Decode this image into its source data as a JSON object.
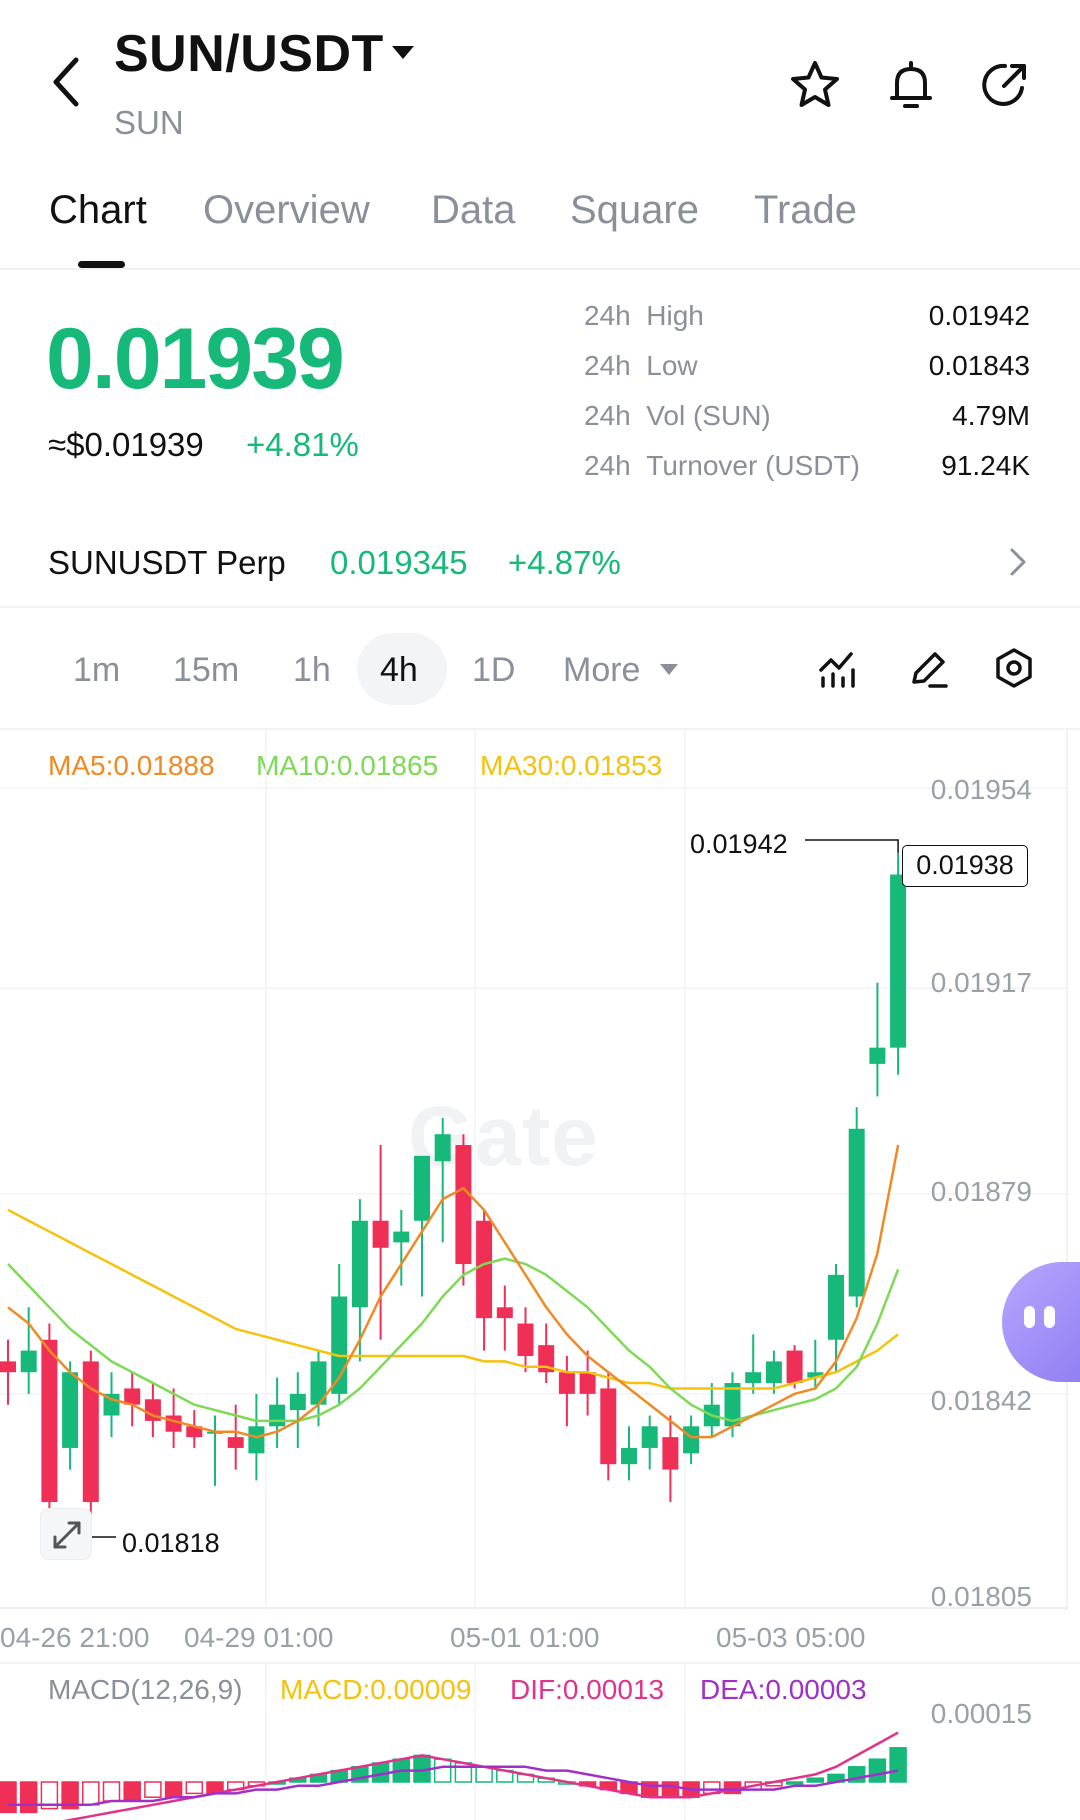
{
  "header": {
    "pair": "SUN/USDT",
    "base": "SUN"
  },
  "tabs": [
    "Chart",
    "Overview",
    "Data",
    "Square",
    "Trade"
  ],
  "price": {
    "last": "0.01939",
    "usd": "≈$0.01939",
    "change": "+4.81%"
  },
  "stats": [
    {
      "period": "24h",
      "label": "High",
      "value": "0.01942"
    },
    {
      "period": "24h",
      "label": "Low",
      "value": "0.01843"
    },
    {
      "period": "24h",
      "label": "Vol (SUN)",
      "value": "4.79M"
    },
    {
      "period": "24h",
      "label": "Turnover (USDT)",
      "value": "91.24K"
    }
  ],
  "perp": {
    "name": "SUNUSDT Perp",
    "price": "0.019345",
    "change": "+4.87%"
  },
  "intervals": {
    "items": [
      "1m",
      "15m",
      "1h",
      "4h",
      "1D",
      "More"
    ],
    "active": "4h"
  },
  "ma_legend": {
    "ma5": "MA5:0.01888",
    "ma10": "MA10:0.01865",
    "ma30": "MA30:0.01853"
  },
  "colors": {
    "up": "#16b979",
    "down": "#ef2f56",
    "ma5": "#f08a24",
    "ma10": "#7ed957",
    "ma30": "#f5c20e",
    "dif": "#e0338b",
    "dea": "#a030c8",
    "macd_label": "#f5c20e"
  },
  "annotations": {
    "high": "0.01942",
    "low": "0.01818",
    "current": "0.01938"
  },
  "watermark": "Gate",
  "macd_legend": {
    "title": "MACD(12,26,9)",
    "macd": "MACD:0.00009",
    "dif": "DIF:0.00013",
    "dea": "DEA:0.00003"
  },
  "macd_axis": "0.00015",
  "chart_data": {
    "type": "candlestick",
    "y_ticks": [
      "0.01954",
      "0.01917",
      "0.01879",
      "0.01842",
      "0.01805"
    ],
    "x_ticks": [
      "04-26 21:00",
      "04-29 01:00",
      "05-01 01:00",
      "05-03 05:00"
    ],
    "ylim": [
      0.01805,
      0.01954
    ],
    "candles": [
      {
        "o": 0.01848,
        "h": 0.01852,
        "l": 0.0184,
        "c": 0.01846
      },
      {
        "o": 0.01846,
        "h": 0.01858,
        "l": 0.01842,
        "c": 0.0185
      },
      {
        "o": 0.01852,
        "h": 0.01855,
        "l": 0.01818,
        "c": 0.01822
      },
      {
        "o": 0.01832,
        "h": 0.01848,
        "l": 0.01828,
        "c": 0.01846
      },
      {
        "o": 0.01848,
        "h": 0.0185,
        "l": 0.01818,
        "c": 0.01822
      },
      {
        "o": 0.01838,
        "h": 0.01846,
        "l": 0.01834,
        "c": 0.01842
      },
      {
        "o": 0.01843,
        "h": 0.01846,
        "l": 0.01836,
        "c": 0.0184
      },
      {
        "o": 0.01841,
        "h": 0.01844,
        "l": 0.01834,
        "c": 0.01837
      },
      {
        "o": 0.01838,
        "h": 0.01843,
        "l": 0.01832,
        "c": 0.01835
      },
      {
        "o": 0.01836,
        "h": 0.01839,
        "l": 0.01832,
        "c": 0.01834
      },
      {
        "o": 0.01835,
        "h": 0.01838,
        "l": 0.01825,
        "c": 0.01835
      },
      {
        "o": 0.01834,
        "h": 0.0184,
        "l": 0.01828,
        "c": 0.01832
      },
      {
        "o": 0.01831,
        "h": 0.01842,
        "l": 0.01826,
        "c": 0.01836
      },
      {
        "o": 0.01836,
        "h": 0.01845,
        "l": 0.01832,
        "c": 0.0184
      },
      {
        "o": 0.01839,
        "h": 0.01846,
        "l": 0.01832,
        "c": 0.01842
      },
      {
        "o": 0.0184,
        "h": 0.0185,
        "l": 0.01836,
        "c": 0.01848
      },
      {
        "o": 0.01842,
        "h": 0.01866,
        "l": 0.0184,
        "c": 0.0186
      },
      {
        "o": 0.01858,
        "h": 0.01878,
        "l": 0.01848,
        "c": 0.01874
      },
      {
        "o": 0.01874,
        "h": 0.01888,
        "l": 0.01852,
        "c": 0.01869
      },
      {
        "o": 0.0187,
        "h": 0.01876,
        "l": 0.01862,
        "c": 0.01872
      },
      {
        "o": 0.01874,
        "h": 0.01885,
        "l": 0.0186,
        "c": 0.01886
      },
      {
        "o": 0.01885,
        "h": 0.01893,
        "l": 0.0187,
        "c": 0.0189
      },
      {
        "o": 0.01888,
        "h": 0.0189,
        "l": 0.01862,
        "c": 0.01866
      },
      {
        "o": 0.01874,
        "h": 0.01876,
        "l": 0.0185,
        "c": 0.01856
      },
      {
        "o": 0.01858,
        "h": 0.01862,
        "l": 0.0185,
        "c": 0.01856
      },
      {
        "o": 0.01855,
        "h": 0.01858,
        "l": 0.01846,
        "c": 0.01849
      },
      {
        "o": 0.01851,
        "h": 0.01855,
        "l": 0.01844,
        "c": 0.01846
      },
      {
        "o": 0.01846,
        "h": 0.01849,
        "l": 0.01836,
        "c": 0.01842
      },
      {
        "o": 0.01846,
        "h": 0.0185,
        "l": 0.01838,
        "c": 0.01842
      },
      {
        "o": 0.01843,
        "h": 0.01846,
        "l": 0.01826,
        "c": 0.01829
      },
      {
        "o": 0.01829,
        "h": 0.01836,
        "l": 0.01826,
        "c": 0.01832
      },
      {
        "o": 0.01832,
        "h": 0.01838,
        "l": 0.01828,
        "c": 0.01836
      },
      {
        "o": 0.01834,
        "h": 0.01838,
        "l": 0.01822,
        "c": 0.01828
      },
      {
        "o": 0.01831,
        "h": 0.01838,
        "l": 0.01829,
        "c": 0.01836
      },
      {
        "o": 0.01836,
        "h": 0.01844,
        "l": 0.01834,
        "c": 0.0184
      },
      {
        "o": 0.01836,
        "h": 0.01846,
        "l": 0.01834,
        "c": 0.01844
      },
      {
        "o": 0.01844,
        "h": 0.01853,
        "l": 0.01842,
        "c": 0.01846
      },
      {
        "o": 0.01844,
        "h": 0.0185,
        "l": 0.01842,
        "c": 0.01848
      },
      {
        "o": 0.0185,
        "h": 0.01851,
        "l": 0.01843,
        "c": 0.01844
      },
      {
        "o": 0.01845,
        "h": 0.01852,
        "l": 0.01843,
        "c": 0.01846
      },
      {
        "o": 0.01852,
        "h": 0.01866,
        "l": 0.01846,
        "c": 0.01864
      },
      {
        "o": 0.0186,
        "h": 0.01895,
        "l": 0.01858,
        "c": 0.01891
      },
      {
        "o": 0.01903,
        "h": 0.01918,
        "l": 0.01897,
        "c": 0.01906
      },
      {
        "o": 0.01906,
        "h": 0.01942,
        "l": 0.01901,
        "c": 0.01938
      }
    ],
    "ma5": [
      0.01858,
      0.01855,
      0.0185,
      0.01846,
      0.01843,
      0.01841,
      0.0184,
      0.01838,
      0.01837,
      0.01836,
      0.01835,
      0.01835,
      0.01834,
      0.01835,
      0.01837,
      0.0184,
      0.01845,
      0.01852,
      0.0186,
      0.01866,
      0.01872,
      0.01878,
      0.0188,
      0.01876,
      0.0187,
      0.01864,
      0.01858,
      0.01853,
      0.01849,
      0.01846,
      0.01843,
      0.0184,
      0.01837,
      0.01834,
      0.01834,
      0.01836,
      0.01838,
      0.0184,
      0.01842,
      0.01843,
      0.01848,
      0.01856,
      0.01868,
      0.01888
    ],
    "ma10": [
      0.01866,
      0.01862,
      0.01858,
      0.01854,
      0.01851,
      0.01848,
      0.01846,
      0.01844,
      0.01842,
      0.0184,
      0.01839,
      0.01838,
      0.01837,
      0.01837,
      0.01837,
      0.01838,
      0.0184,
      0.01843,
      0.01847,
      0.01851,
      0.01855,
      0.0186,
      0.01864,
      0.01866,
      0.01867,
      0.01866,
      0.01864,
      0.01861,
      0.01858,
      0.01854,
      0.0185,
      0.01847,
      0.01843,
      0.0184,
      0.01838,
      0.01837,
      0.01838,
      0.01839,
      0.0184,
      0.01841,
      0.01843,
      0.01847,
      0.01855,
      0.01865
    ],
    "ma30": [
      0.01876,
      0.01874,
      0.01872,
      0.0187,
      0.01868,
      0.01866,
      0.01864,
      0.01862,
      0.0186,
      0.01858,
      0.01856,
      0.01854,
      0.01853,
      0.01852,
      0.01851,
      0.0185,
      0.01849,
      0.01849,
      0.01849,
      0.01849,
      0.01849,
      0.01849,
      0.01849,
      0.01848,
      0.01848,
      0.01847,
      0.01847,
      0.01846,
      0.01846,
      0.01845,
      0.01844,
      0.01844,
      0.01843,
      0.01843,
      0.01843,
      0.01843,
      0.01843,
      0.01843,
      0.01844,
      0.01845,
      0.01846,
      0.01848,
      0.0185,
      0.01853
    ],
    "macd_hist": [
      -8e-05,
      -8e-05,
      -7e-05,
      -7e-05,
      -6e-05,
      -5e-05,
      -5e-05,
      -4e-05,
      -4e-05,
      -3e-05,
      -3e-05,
      -2e-05,
      -1e-05,
      0.0,
      1e-05,
      2e-05,
      3e-05,
      4e-05,
      5e-05,
      6e-05,
      7e-05,
      6e-05,
      5e-05,
      4e-05,
      3e-05,
      2e-05,
      1e-05,
      0.0,
      -1e-05,
      -2e-05,
      -3e-05,
      -4e-05,
      -4e-05,
      -4e-05,
      -3e-05,
      -3e-05,
      -2e-05,
      -1e-05,
      0.0,
      1e-05,
      2e-05,
      4e-05,
      6e-05,
      9e-05
    ],
    "dif": [
      -0.00012,
      -0.00012,
      -0.00011,
      -0.0001,
      -9e-05,
      -8e-05,
      -7e-05,
      -6e-05,
      -5e-05,
      -4e-05,
      -3e-05,
      -2e-05,
      -1e-05,
      0.0,
      1e-05,
      2e-05,
      3e-05,
      4e-05,
      5e-05,
      6e-05,
      7e-05,
      6e-05,
      5e-05,
      4e-05,
      3e-05,
      2e-05,
      1e-05,
      0.0,
      -1e-05,
      -2e-05,
      -3e-05,
      -4e-05,
      -4e-05,
      -4e-05,
      -3e-05,
      -2e-05,
      -1e-05,
      0.0,
      1e-05,
      2e-05,
      4e-05,
      7e-05,
      0.0001,
      0.00013
    ],
    "dea": [
      -6e-05,
      -6e-05,
      -6e-05,
      -6e-05,
      -6e-05,
      -5e-05,
      -5e-05,
      -5e-05,
      -4e-05,
      -4e-05,
      -3e-05,
      -3e-05,
      -2e-05,
      -2e-05,
      -1e-05,
      -1e-05,
      0.0,
      1e-05,
      2e-05,
      3e-05,
      3e-05,
      4e-05,
      4e-05,
      4e-05,
      4e-05,
      4e-05,
      3e-05,
      3e-05,
      2e-05,
      1e-05,
      0.0,
      -1e-05,
      -1e-05,
      -2e-05,
      -2e-05,
      -2e-05,
      -2e-05,
      -2e-05,
      -1e-05,
      -1e-05,
      0.0,
      1e-05,
      2e-05,
      3e-05
    ]
  }
}
